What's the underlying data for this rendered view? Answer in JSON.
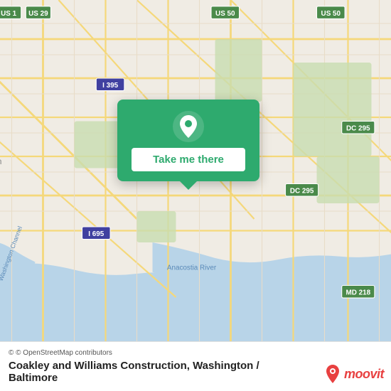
{
  "map": {
    "background_color": "#e8e0d8",
    "popup": {
      "button_label": "Take me there",
      "bg_color": "#2eaa6e",
      "pin_icon": "map-pin"
    }
  },
  "bottom_bar": {
    "osm_credit": "© OpenStreetMap contributors",
    "location_name": "Coakley and Williams Construction, Washington /",
    "location_sub": "Baltimore"
  },
  "moovit": {
    "text": "moovit"
  }
}
